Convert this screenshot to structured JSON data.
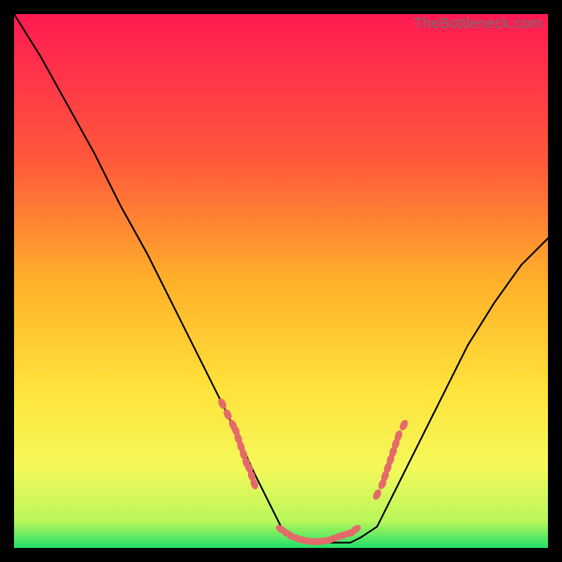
{
  "watermark": "TheBottleneck.com",
  "colors": {
    "bg_black": "#000000",
    "grad_top": "#ff1a52",
    "grad_mid1": "#ff7e2a",
    "grad_mid2": "#ffd22a",
    "grad_mid3": "#fdf84e",
    "grad_bottom": "#22e06a",
    "curve": "#000000",
    "dots": "#e46a6a"
  },
  "chart_data": {
    "type": "line",
    "title": "",
    "xlabel": "",
    "ylabel": "",
    "xlim": [
      0,
      100
    ],
    "ylim": [
      0,
      100
    ],
    "note": "Axes are unlabeled; values below are estimated from pixel position. y=100 is top of gradient, y=0 is bottom (green edge).",
    "series": [
      {
        "name": "bottleneck-curve",
        "x": [
          0,
          5,
          10,
          15,
          20,
          25,
          30,
          35,
          40,
          45,
          48,
          50,
          53,
          55,
          58,
          60,
          63,
          65,
          68,
          70,
          75,
          80,
          85,
          90,
          95,
          100
        ],
        "y": [
          100,
          92,
          83,
          74,
          64,
          55,
          45,
          35,
          25,
          14,
          8,
          4,
          2,
          1,
          1,
          1,
          1,
          2,
          4,
          8,
          18,
          28,
          38,
          46,
          53,
          58
        ]
      }
    ],
    "markers": [
      {
        "name": "left-cluster",
        "x": [
          39,
          40,
          41,
          41.5,
          42,
          42.5,
          43,
          43.5,
          44,
          44.5,
          45
        ],
        "y": [
          27,
          25,
          23,
          22,
          20.5,
          19,
          17.5,
          16,
          15,
          13.5,
          12
        ]
      },
      {
        "name": "bottom-cluster",
        "x": [
          50,
          51,
          52,
          53,
          54,
          55,
          56,
          57,
          58,
          59,
          60,
          61,
          62,
          63,
          64
        ],
        "y": [
          3.5,
          2.8,
          2.2,
          1.8,
          1.5,
          1.3,
          1.2,
          1.2,
          1.3,
          1.5,
          1.8,
          2.2,
          2.5,
          2.8,
          3.5
        ]
      },
      {
        "name": "right-cluster",
        "x": [
          68,
          69,
          69.5,
          70,
          70.5,
          71,
          71.5,
          72,
          73
        ],
        "y": [
          10,
          12,
          13.5,
          15,
          16.5,
          18,
          19.5,
          21,
          23
        ]
      }
    ]
  }
}
